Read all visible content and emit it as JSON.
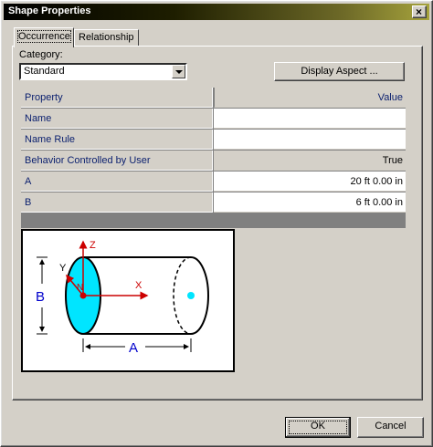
{
  "window": {
    "title": "Shape Properties",
    "close_symbol": "×"
  },
  "tabs": [
    {
      "label": "Occurrence",
      "active": true
    },
    {
      "label": "Relationship",
      "active": false
    }
  ],
  "category": {
    "label": "Category:",
    "selected": "Standard"
  },
  "display_aspect_label": "Display Aspect ...",
  "grid": {
    "headers": {
      "property": "Property",
      "value": "Value"
    },
    "rows": [
      {
        "property": "Name",
        "value": ""
      },
      {
        "property": "Name Rule",
        "value": ""
      },
      {
        "property": "Behavior Controlled by User",
        "value": "True"
      },
      {
        "property": "A",
        "value": "20 ft  0.00 in"
      },
      {
        "property": "B",
        "value": "6 ft  0.00 in"
      }
    ]
  },
  "diagram": {
    "dimension_a": "A",
    "dimension_b": "B",
    "axis_x": "X",
    "axis_y": "Y",
    "axis_z": "Z",
    "origin": "N",
    "colors": {
      "face": "#00e5ff",
      "axis": "#cc0000",
      "dimension": "#0000cc"
    }
  },
  "buttons": {
    "ok": "OK",
    "cancel": "Cancel"
  }
}
